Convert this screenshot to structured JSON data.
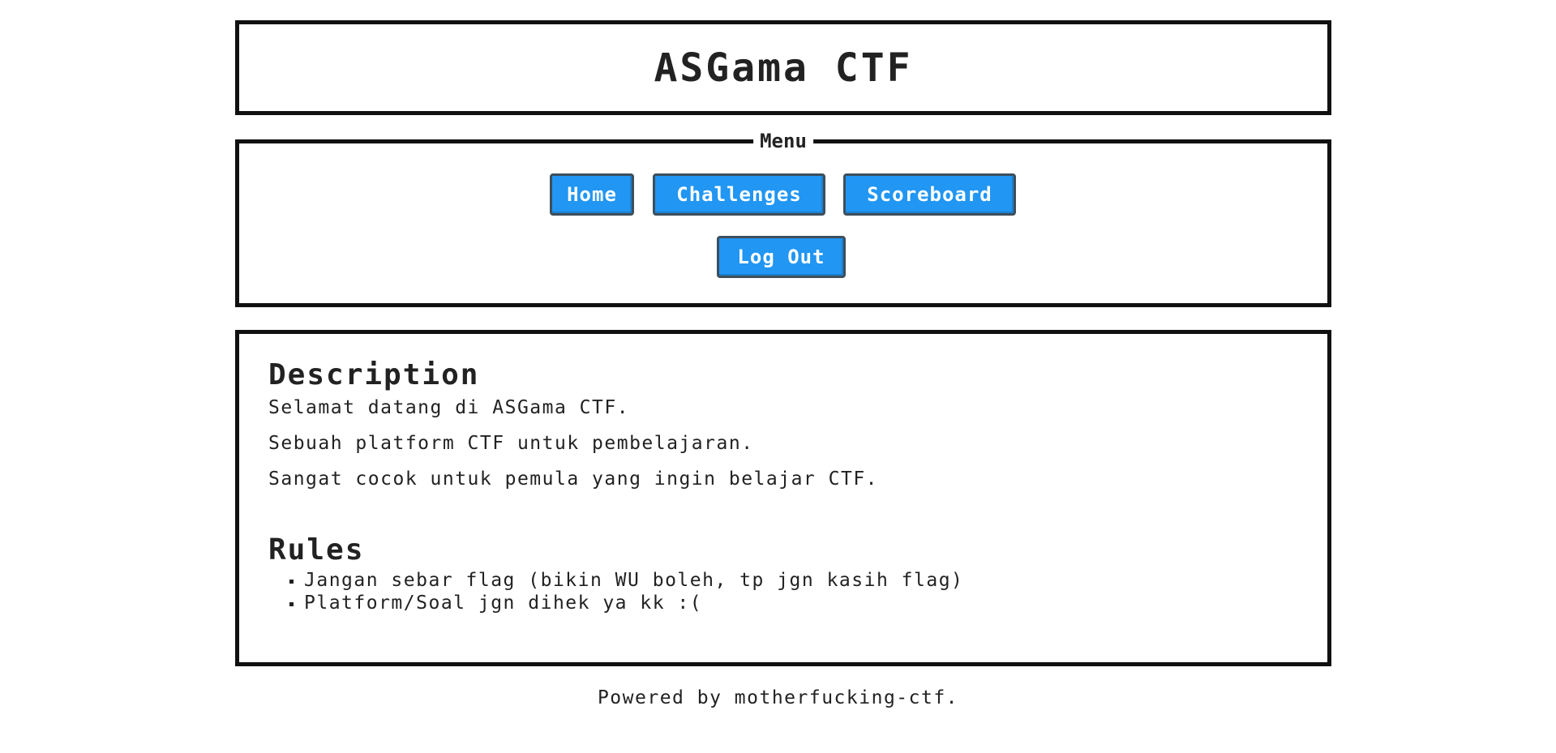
{
  "header": {
    "title": "ASGama CTF"
  },
  "menu": {
    "legend": "Menu",
    "buttons": {
      "home": "Home",
      "challenges": "Challenges",
      "scoreboard": "Scoreboard",
      "logout": "Log Out"
    },
    "button_color": "#2196f3"
  },
  "content": {
    "description_heading": "Description",
    "description_lines": [
      "Selamat datang di ASGama CTF.",
      "Sebuah platform CTF untuk pembelajaran.",
      "Sangat cocok untuk pemula yang ingin belajar CTF."
    ],
    "rules_heading": "Rules",
    "rules": [
      "Jangan sebar flag (bikin WU boleh, tp jgn kasih flag)",
      "Platform/Soal jgn dihek ya kk :("
    ]
  },
  "footer": {
    "text": "Powered by motherfucking-ctf."
  }
}
